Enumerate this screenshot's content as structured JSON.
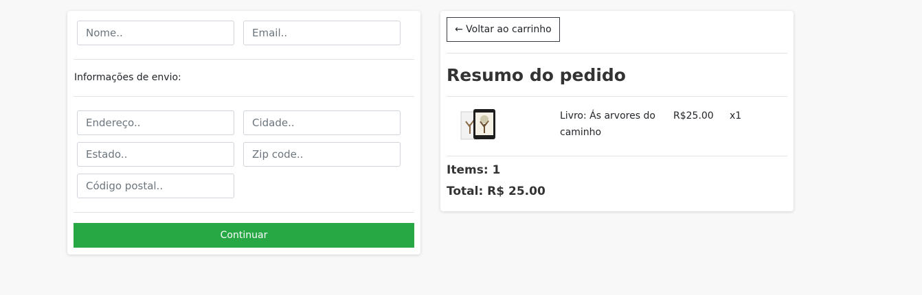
{
  "form": {
    "name_placeholder": "Nome..",
    "email_placeholder": "Email..",
    "shipping_label": "Informações de envio:",
    "address_placeholder": "Endereço..",
    "city_placeholder": "Cidade..",
    "state_placeholder": "Estado..",
    "zip_placeholder": "Zip code..",
    "postal_placeholder": "Código postal..",
    "continue_label": "Continuar"
  },
  "summary": {
    "back_label": "← Voltar ao carrinho",
    "title": "Resumo do pedido",
    "item": {
      "name": "Livro: Ás arvores do caminho",
      "price": "R$25.00",
      "quantity": "x1",
      "thumbnail_icon": "book-tablet-icon"
    },
    "items_count": "Items: 1",
    "total": "Total: R$ 25.00"
  },
  "colors": {
    "accent": "#28a745",
    "background": "#f8f8f8"
  }
}
